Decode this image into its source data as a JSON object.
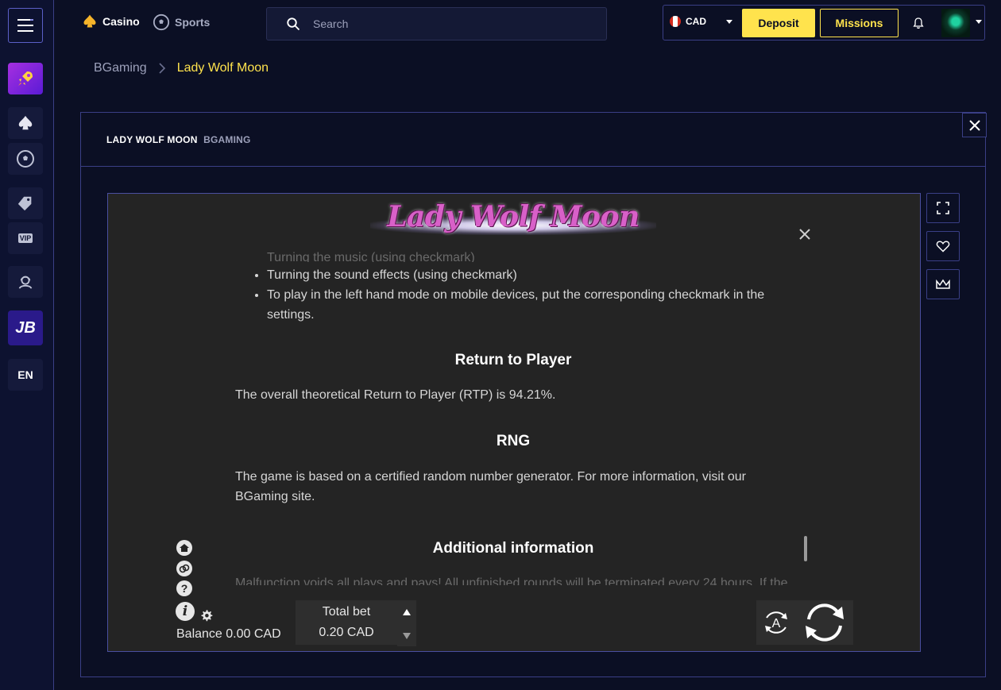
{
  "header": {
    "nav": {
      "casino": "Casino",
      "sports": "Sports"
    },
    "search_placeholder": "Search",
    "currency": "CAD",
    "deposit_label": "Deposit",
    "missions_label": "Missions"
  },
  "sidebar": {
    "jb_label": "JB",
    "vip_label": "VIP",
    "language": "EN"
  },
  "breadcrumb": {
    "parent": "BGaming",
    "current": "Lady Wolf Moon"
  },
  "modal": {
    "game_title": "LADY WOLF MOON",
    "provider": "BGAMING"
  },
  "game": {
    "logo_text": "Lady Wolf Moon",
    "rules": {
      "list_items": [
        "Turning the music (using checkmark)",
        "Turning the sound effects (using checkmark)",
        "To play in the left hand mode on mobile devices, put the corresponding checkmark in the settings."
      ],
      "rtp_heading": "Return to Player",
      "rtp_text": "The overall theoretical Return to Player (RTP) is 94.21%.",
      "rng_heading": "RNG",
      "rng_text": "The game is based on a certified random number generator. For more information, visit our BGaming site.",
      "additional_heading": "Additional information",
      "additional_text": "Malfunction voids all plays and pays! All unfinished rounds will be terminated every 24 hours. If the"
    },
    "balance_text": "Balance 0.00 CAD",
    "total_bet_label": "Total bet",
    "total_bet_value": "0.20 CAD",
    "auto_label": "A"
  }
}
